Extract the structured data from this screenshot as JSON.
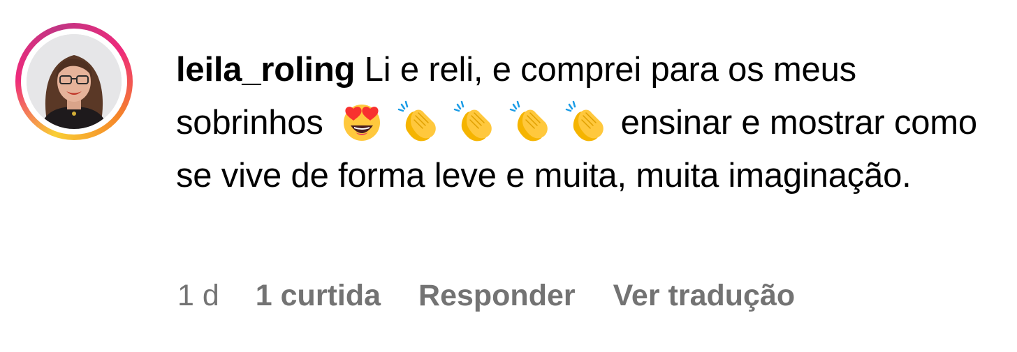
{
  "comment": {
    "username": "leila_roling",
    "text_part1": "Li e reli, e comprei para os meus sobrinhos",
    "emojis": [
      "heart-eyes-emoji",
      "clapping-hands-emoji",
      "clapping-hands-emoji",
      "clapping-hands-emoji",
      "clapping-hands-emoji"
    ],
    "text_part2": "ensinar e mostrar como se vive de forma leve e muita, muita imaginação."
  },
  "meta": {
    "time": "1 d",
    "likes": "1 curtida",
    "reply": "Responder",
    "translate": "Ver tradução"
  },
  "colors": {
    "meta_text": "#737373",
    "story_ring_start": "#f9ce34",
    "story_ring_end": "#c13584"
  }
}
